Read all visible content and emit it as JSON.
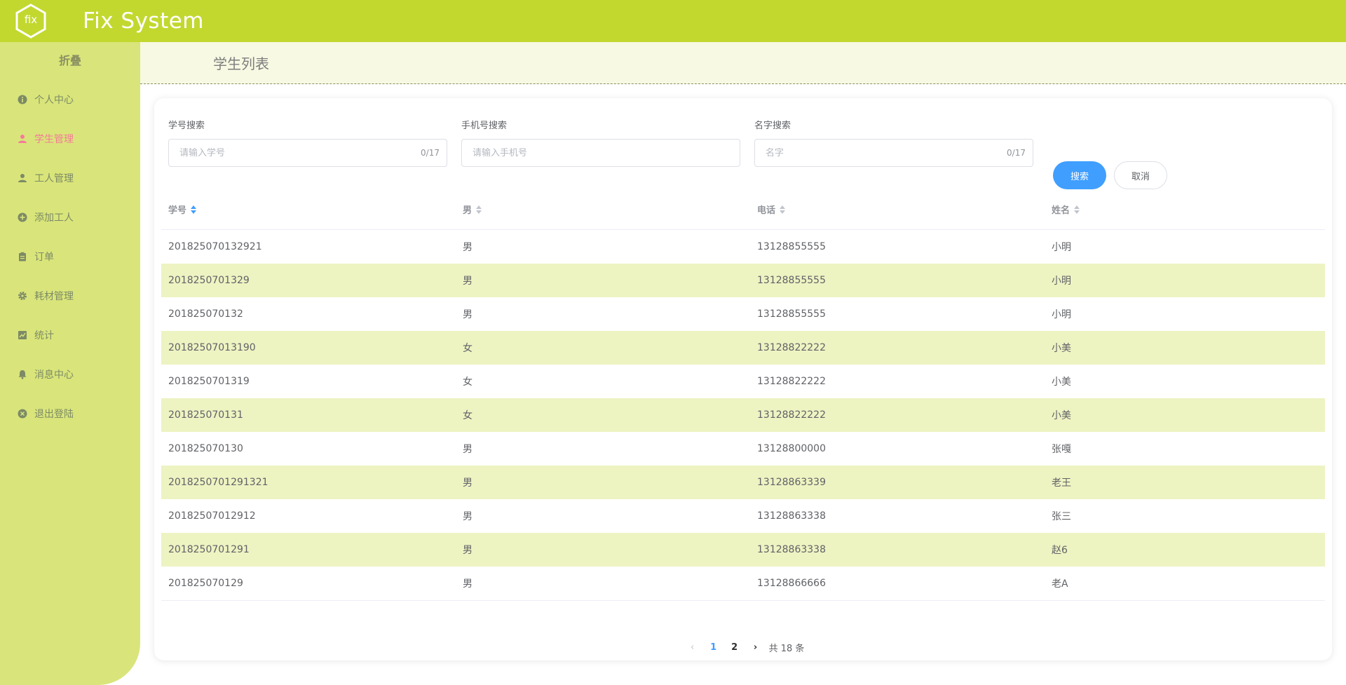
{
  "header": {
    "title": "Fix System",
    "logo_text": "fix"
  },
  "sidebar": {
    "collapse_label": "折叠",
    "items": [
      {
        "label": "个人中心",
        "icon": "info-icon"
      },
      {
        "label": "学生管理",
        "icon": "user-icon"
      },
      {
        "label": "工人管理",
        "icon": "user-icon"
      },
      {
        "label": "添加工人",
        "icon": "plus-circle-icon"
      },
      {
        "label": "订单",
        "icon": "clipboard-icon"
      },
      {
        "label": "耗材管理",
        "icon": "gear-icon"
      },
      {
        "label": "统计",
        "icon": "chart-icon"
      },
      {
        "label": "消息中心",
        "icon": "bell-icon"
      },
      {
        "label": "退出登陆",
        "icon": "close-circle-icon"
      }
    ],
    "active_index": 1
  },
  "page": {
    "title": "学生列表"
  },
  "search": {
    "id": {
      "label": "学号搜索",
      "placeholder": "请输入学号",
      "counter": "0/17"
    },
    "phone": {
      "label": "手机号搜索",
      "placeholder": "请输入手机号"
    },
    "name": {
      "label": "名字搜索",
      "placeholder": "名字",
      "counter": "0/17"
    },
    "search_button": "搜索",
    "cancel_button": "取消"
  },
  "table": {
    "columns": [
      "学号",
      "男",
      "电话",
      "姓名"
    ],
    "rows": [
      [
        "201825070132921",
        "男",
        "13128855555",
        "小明"
      ],
      [
        "2018250701329",
        "男",
        "13128855555",
        "小明"
      ],
      [
        "201825070132",
        "男",
        "13128855555",
        "小明"
      ],
      [
        "20182507013190",
        "女",
        "13128822222",
        "小美"
      ],
      [
        "2018250701319",
        "女",
        "13128822222",
        "小美"
      ],
      [
        "201825070131",
        "女",
        "13128822222",
        "小美"
      ],
      [
        "201825070130",
        "男",
        "13128800000",
        "张嘎"
      ],
      [
        "2018250701291321",
        "男",
        "13128863339",
        "老王"
      ],
      [
        "20182507012912",
        "男",
        "13128863338",
        "张三"
      ],
      [
        "2018250701291",
        "男",
        "13128863338",
        "赵6"
      ],
      [
        "201825070129",
        "男",
        "13128866666",
        "老A"
      ]
    ]
  },
  "pagination": {
    "pages": [
      "1",
      "2"
    ],
    "current": "1",
    "total": "共 18 条"
  },
  "colors": {
    "topbar": "#c2d82f",
    "sidebar": "#d9e57a",
    "active": "#f57b99",
    "primary": "#409eff",
    "stripe": "#eef3c2"
  }
}
